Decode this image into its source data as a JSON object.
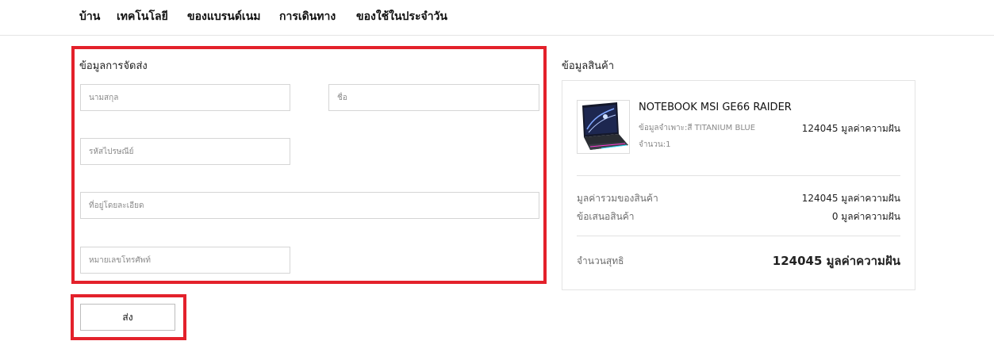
{
  "nav": {
    "items": [
      "บ้าน",
      "เทคโนโลยี",
      "ของแบรนด์เนม",
      "การเดินทาง",
      "ของใช้ในประจำวัน"
    ]
  },
  "shipping_form": {
    "title": "ข้อมูลการจัดส่ง",
    "last_name": {
      "value": "",
      "placeholder": "นามสกุล"
    },
    "first_name": {
      "value": "",
      "placeholder": "ชื่อ"
    },
    "postal_code": {
      "value": "",
      "placeholder": "รหัสไปรษณีย์"
    },
    "address": {
      "value": "",
      "placeholder": "ที่อยู่โดยละเอียด"
    },
    "phone": {
      "value": "",
      "placeholder": "หมายเลขโทรศัพท์"
    },
    "submit_label": "ส่ง"
  },
  "product_info": {
    "heading": "ข้อมูลสินค้า",
    "item": {
      "name": "NOTEBOOK MSI GE66 RAIDER",
      "spec": "ข้อมูลจำเพาะ:สี TITANIUM BLUE",
      "quantity": "จำนวน:1",
      "price": "124045 มูลค่าความฝัน",
      "image": "laptop-product-image"
    },
    "subtotal_label": "มูลค่ารวมของสินค้า",
    "subtotal_value": "124045 มูลค่าความฝัน",
    "discount_label": "ข้อเสนอสินค้า",
    "discount_value": "0 มูลค่าความฝัน",
    "total_label": "จำนวนสุทธิ",
    "total_value": "124045 มูลค่าความฝัน"
  },
  "colors": {
    "highlight": "#e3212b",
    "border": "#d5d5d5"
  }
}
